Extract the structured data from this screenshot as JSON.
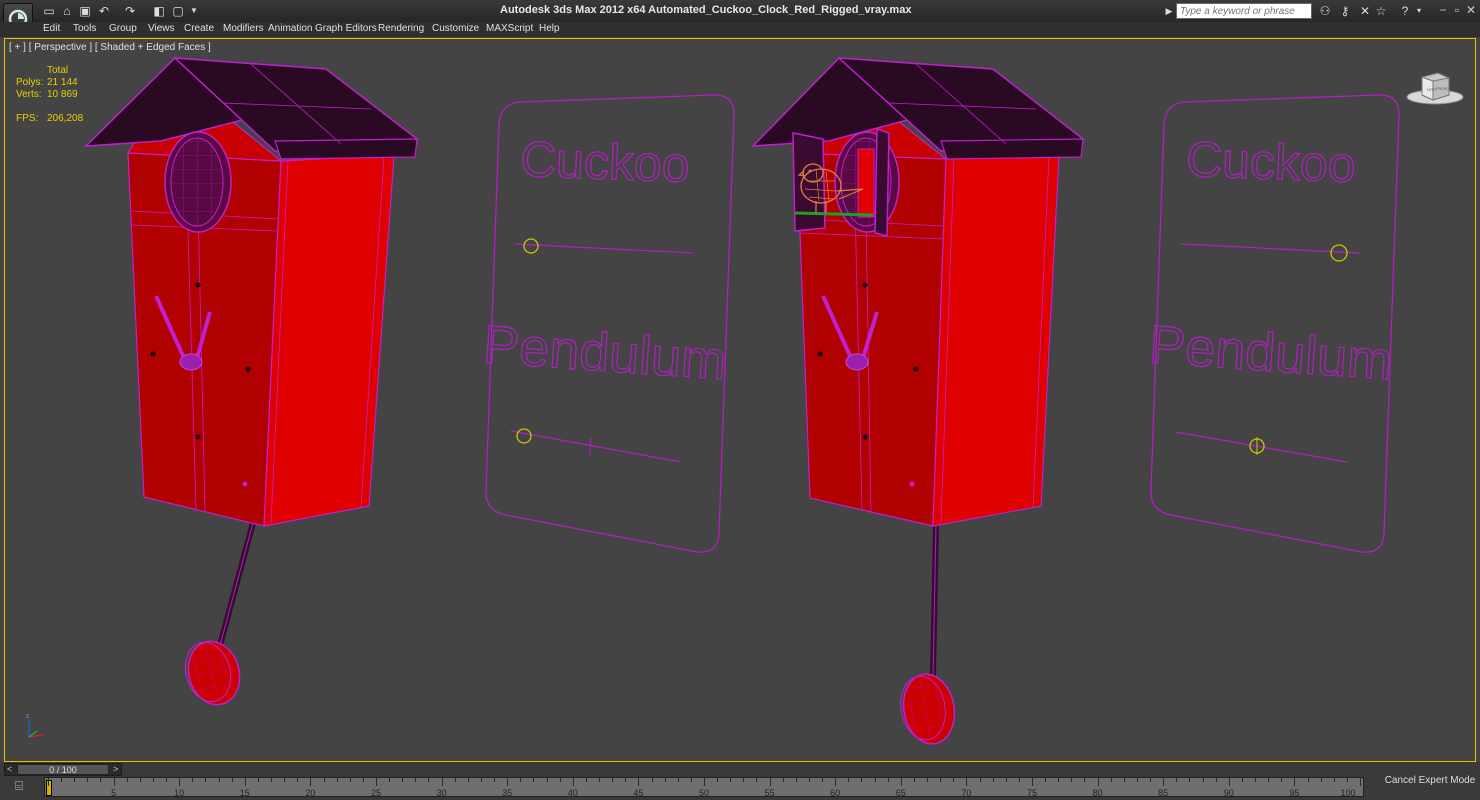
{
  "app": {
    "title": "Autodesk 3ds Max  2012 x64     Automated_Cuckoo_Clock_Red_Rigged_vray.max",
    "search_placeholder": "Type a keyword or phrase"
  },
  "menu": [
    "Edit",
    "Tools",
    "Group",
    "Views",
    "Create",
    "Modifiers",
    "Animation",
    "Graph Editors",
    "Rendering",
    "Customize",
    "MAXScript",
    "Help"
  ],
  "viewport": {
    "label": "[ + ] [ Perspective ] [ Shaded + Edged Faces ]",
    "stats": {
      "header": "Total",
      "polys_label": "Polys:",
      "polys": "21 144",
      "verts_label": "Verts:",
      "verts": "10 869",
      "fps_label": "FPS:",
      "fps": "206,208"
    },
    "panel_text_top": "Cuckoo",
    "panel_text_bottom": "Pendulum",
    "viewcube": {
      "front": "FRONT",
      "left": "LEFT"
    }
  },
  "timeline": {
    "slider_value": "0 / 100",
    "current_frame": 0,
    "total_frames": 100,
    "ticks": [
      "5",
      "10",
      "15",
      "20",
      "25",
      "30",
      "35",
      "40",
      "45",
      "50",
      "55",
      "60",
      "65",
      "70",
      "75",
      "80",
      "85",
      "90",
      "95",
      "100"
    ]
  },
  "cancel_expert_label": "Cancel Expert Mode",
  "colors": {
    "body_red": "#cc0000",
    "wire": "#c020d0",
    "roof": "#2a0a22",
    "viewport_bg": "#444444",
    "active_border": "#f0c000"
  }
}
